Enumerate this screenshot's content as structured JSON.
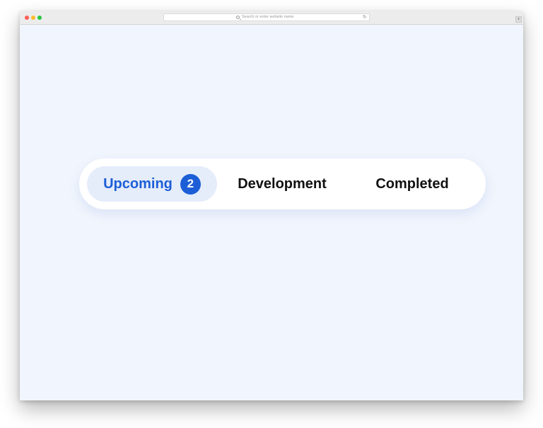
{
  "browser": {
    "address_placeholder": "Search or enter website name",
    "reload_glyph": "↻",
    "new_tab_glyph": "+"
  },
  "tabs": [
    {
      "label": "Upcoming",
      "badge": "2",
      "active": true
    },
    {
      "label": "Development",
      "active": false
    },
    {
      "label": "Completed",
      "active": false
    }
  ],
  "colors": {
    "accent": "#1c5ed6",
    "active_tab_bg": "#e5ecfa",
    "page_bg": "#f1f5fd"
  }
}
